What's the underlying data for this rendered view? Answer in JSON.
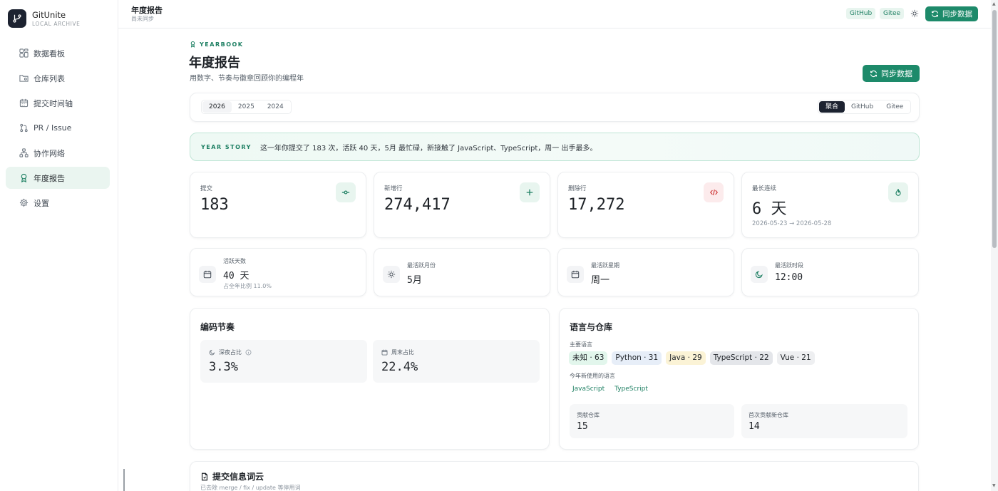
{
  "app": {
    "name": "GitUnite",
    "subtitle": "LOCAL ARCHIVE"
  },
  "sidebar": {
    "items": [
      {
        "label": "数据看板",
        "icon": "dashboard-icon"
      },
      {
        "label": "仓库列表",
        "icon": "folder-icon"
      },
      {
        "label": "提交时间轴",
        "icon": "calendar-icon"
      },
      {
        "label": "PR / Issue",
        "icon": "pull-request-icon"
      },
      {
        "label": "协作网络",
        "icon": "network-icon"
      },
      {
        "label": "年度报告",
        "icon": "award-icon",
        "active": true
      },
      {
        "label": "设置",
        "icon": "gear-icon"
      }
    ]
  },
  "topbar": {
    "title": "年度报告",
    "subtitle": "尚未同步",
    "chips": [
      "GitHub",
      "Gitee"
    ],
    "sync_label": "同步数据"
  },
  "header": {
    "tag": "YEARBOOK",
    "title": "年度报告",
    "description": "用数字、节奏与徽章回顾你的编程年",
    "sync_label": "同步数据"
  },
  "filters": {
    "years": [
      "2026",
      "2025",
      "2024"
    ],
    "selected_year": "2026",
    "sources": [
      "聚合",
      "GitHub",
      "Gitee"
    ],
    "selected_source": "聚合"
  },
  "story": {
    "tag": "YEAR STORY",
    "text": "这一年你提交了 183 次，活跃 40 天，5月 最忙碌，新接触了 JavaScript、TypeScript，周一 出手最多。"
  },
  "stats": [
    {
      "label": "提交",
      "value": "183",
      "icon": "commit-icon",
      "foot": ""
    },
    {
      "label": "新增行",
      "value": "274,417",
      "icon": "plus-icon",
      "foot": ""
    },
    {
      "label": "删除行",
      "value": "17,272",
      "icon": "code-icon",
      "foot": ""
    },
    {
      "label": "最长连续",
      "value": "6 天",
      "icon": "flame-icon",
      "foot": "2026-05-23 → 2026-05-28"
    }
  ],
  "mini_stats": [
    {
      "label": "活跃天数",
      "value": "40 天",
      "foot": "占全年比例 11.0%",
      "icon": "calendar-icon"
    },
    {
      "label": "最活跃月份",
      "value": "5月",
      "foot": "",
      "icon": "sun-icon"
    },
    {
      "label": "最活跃星期",
      "value": "周一",
      "foot": "",
      "icon": "calendar-icon"
    },
    {
      "label": "最活跃时段",
      "value": "12:00",
      "foot": "",
      "icon": "moon-icon"
    }
  ],
  "rhythm": {
    "title": "编码节奏",
    "metrics": [
      {
        "label": "深夜占比",
        "value": "3.3%",
        "icon": "moon-icon"
      },
      {
        "label": "周末占比",
        "value": "22.4%",
        "icon": "calendar-icon"
      }
    ]
  },
  "languages": {
    "title": "语言与仓库",
    "main_label": "主要语言",
    "main": [
      {
        "label": "未知 · 63",
        "bg": "#e2f6ec",
        "fg": "#1f2328"
      },
      {
        "label": "Python · 31",
        "bg": "#e7eef8",
        "fg": "#1f2328"
      },
      {
        "label": "Java · 29",
        "bg": "#fbf3d6",
        "fg": "#1f2328"
      },
      {
        "label": "TypeScript · 22",
        "bg": "#e4e6ea",
        "fg": "#1f2328"
      },
      {
        "label": "Vue · 21",
        "bg": "#eeeff1",
        "fg": "#1f2328"
      }
    ],
    "new_label": "今年新使用的语言",
    "new": [
      "JavaScript",
      "TypeScript"
    ],
    "repos": [
      {
        "label": "贡献仓库",
        "value": "15"
      },
      {
        "label": "首次贡献新仓库",
        "value": "14"
      }
    ]
  },
  "wordcloud": {
    "title": "提交信息词云",
    "subtitle": "已去除 merge / fix / update 等停用词"
  },
  "colors": {
    "accent": "#1d8a6a",
    "accent_light": "#e8f5ef",
    "dark": "#1c2230"
  }
}
